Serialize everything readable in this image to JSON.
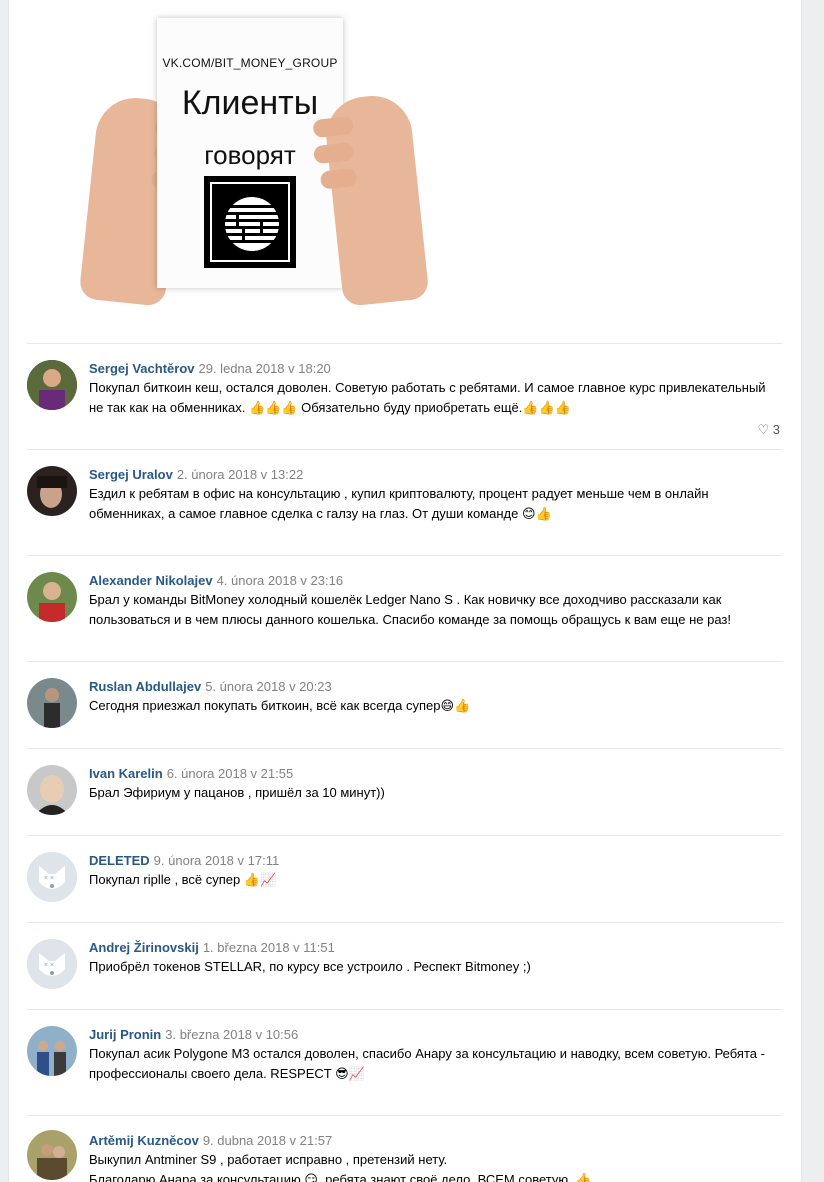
{
  "poster": {
    "url": "VK.COM/BIT_MONEY_GROUP",
    "line1": "Клиенты",
    "line2": "говорят"
  },
  "comments": [
    {
      "author": "Sergej Vachtěrov",
      "date": "29. ledna 2018 v 18:20",
      "line1": "Покупал биткоин кеш, остался доволен. Советую работать с ребятами. И самое главное курс привлекательный",
      "line2": "не так как на обменниках. 👍👍👍 Обязательно буду приобретать ещё.👍👍👍",
      "likes": "3"
    },
    {
      "author": "Sergej Uralov",
      "date": "2. února 2018 v 13:22",
      "line1": "Ездил к ребятам в офис на консультацию , купил криптовалюту, процент радует меньше чем в онлайн",
      "line2": "обменниках, а самое главное сделка с галзу на глаз. От души команде 😊👍"
    },
    {
      "author": "Alexander Nikolajev",
      "date": "4. února 2018 v 23:16",
      "line1": "Брал у команды BitMoney холодный кошелёк Ledger Nano S . Как новичку все доходчиво рассказали как",
      "line2": "пользоваться и в чем плюсы данного кошелька. Спасибо команде за помощь обращусь к вам еще не раз!"
    },
    {
      "author": "Ruslan Abdullajev",
      "date": "5. února 2018 v 20:23",
      "line1": "Сегодня приезжал покупать биткоин, всё как всегда супер😄👍"
    },
    {
      "author": "Ivan Karelin",
      "date": "6. února 2018 v 21:55",
      "line1": "Брал Эфириум у пацанов , пришёл за 10 минут))"
    },
    {
      "author": "DELETED",
      "date": "9. února 2018 v 17:11",
      "line1": "Покупал riplle , всё супер 👍📈"
    },
    {
      "author": "Andrej Žirinovskij",
      "date": "1. března 2018 v 11:51",
      "line1": "Приобрёл токенов STELLAR, по курсу все устроило . Респект Bitmoney ;)"
    },
    {
      "author": "Jurij Pronin",
      "date": "3. března 2018 v 10:56",
      "line1": "Покупал асик Polygone M3 остался доволен, спасибо Анару за консультацию и наводку, всем советую. Ребята -",
      "line2": "профессионалы своего дела. RESPECT 😎📈"
    },
    {
      "author": "Artěmij Kuzněcov",
      "date": "9. dubna 2018 v 21:57",
      "line1": "Выкупил Antminer S9 , работает исправно , претензий нету.",
      "line2": "Благодарю Анара за консультацию 😏, ребята знают своё дело. ВСЕМ советую. 👍"
    }
  ],
  "colors": {
    "author": "#2a5885",
    "date": "#828282",
    "divider": "#e7e8ec"
  }
}
